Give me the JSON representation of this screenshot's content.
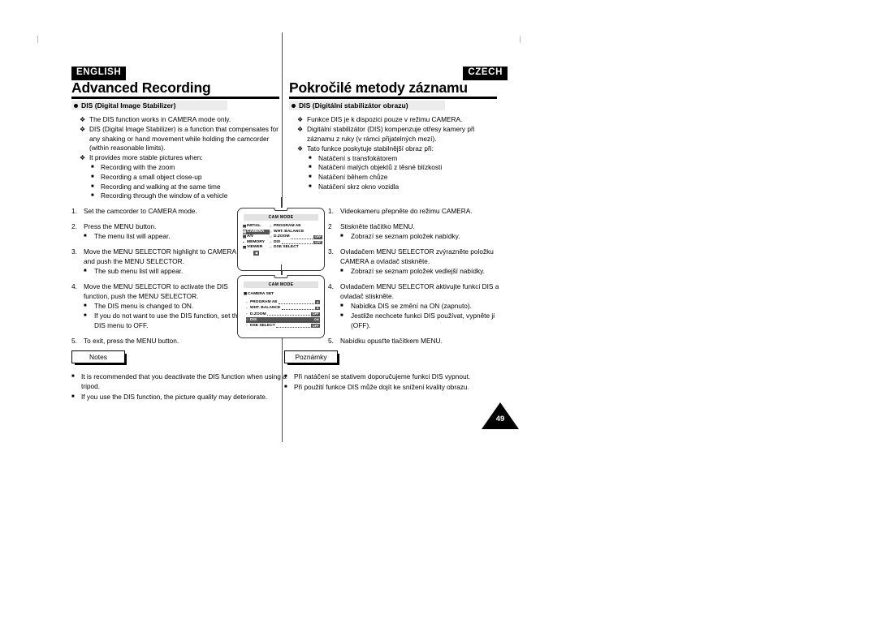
{
  "header": {
    "english_tag": "ENGLISH",
    "czech_tag": "CZECH",
    "title_en": "Advanced Recording",
    "title_cz": "Pokročilé metody záznamu"
  },
  "english": {
    "subheading": "DIS (Digital Image Stabilizer)",
    "features": [
      {
        "mark": "❖",
        "text": "The DIS function works in CAMERA mode only."
      },
      {
        "mark": "❖",
        "text": "DIS (Digital Image Stabilizer) is a function that compensates for any shaking or hand movement while holding the camcorder (within reasonable limits)."
      },
      {
        "mark": "❖",
        "text": "It provides more stable pictures when:"
      }
    ],
    "feature_subitems": [
      "Recording with the zoom",
      "Recording a small object close-up",
      "Recording and walking at the same time",
      "Recording through the window of a vehicle"
    ],
    "steps": [
      {
        "num": "1.",
        "text": "Set the camcorder to CAMERA mode.",
        "subs": []
      },
      {
        "num": "2.",
        "text": "Press the MENU button.",
        "subs": [
          "The menu list will appear."
        ]
      },
      {
        "num": "3.",
        "text": "Move the MENU SELECTOR highlight to CAMERA and push the MENU SELECTOR.",
        "subs": [
          "The sub menu list will appear."
        ]
      },
      {
        "num": "4.",
        "text": "Move the MENU SELECTOR to activate the DIS function, push the MENU SELECTOR.",
        "subs": [
          "The DIS menu is changed to ON.",
          "If you do not want to use the DIS function, set the DIS menu to OFF."
        ]
      },
      {
        "num": "5.",
        "text": "To exit, press the MENU button.",
        "subs": []
      }
    ],
    "notes_label": "Notes",
    "notes": [
      "It is recommended that you deactivate the DIS function when using a tripod.",
      "If you use the DIS function, the picture quality may deteriorate."
    ]
  },
  "czech": {
    "subheading": "DIS (Digitální stabilizátor obrazu)",
    "features": [
      {
        "mark": "❖",
        "text": "Funkce DIS je k dispozici pouze v režimu CAMERA."
      },
      {
        "mark": "❖",
        "text": "Digitální stabilizátor (DIS) kompenzuje otřesy kamery při záznamu z ruky (v rámci přijatelných mezí)."
      },
      {
        "mark": "❖",
        "text": "Tato funkce poskytuje stabilnější obraz při:"
      }
    ],
    "feature_subitems": [
      "Natáčení s transfokátorem",
      "Natáčení malých objektů z těsné blízkosti",
      "Natáčení během chůze",
      "Natáčení skrz okno vozidla"
    ],
    "steps": [
      {
        "num": "1.",
        "text": "Videokameru přepněte do režimu CAMERA.",
        "subs": []
      },
      {
        "num": "2",
        "text": "Stiskněte tlačítko MENU.",
        "subs": [
          "Zobrazí se seznam položek nabídky."
        ]
      },
      {
        "num": "3.",
        "text": "Ovladačem MENU SELECTOR zvýrazněte položku CAMERA a ovladač stiskněte.",
        "subs": [
          "Zobrazí se seznam položek vedlejší nabídky."
        ]
      },
      {
        "num": "4.",
        "text": "Ovladačem MENU SELECTOR aktivujte funkci DIS a ovladač stiskněte.",
        "subs": [
          "Nabídka DIS se změní na ON (zapnuto).",
          "Jestliže nechcete funkci DIS používat, vypněte ji (OFF)."
        ]
      },
      {
        "num": "5.",
        "text": "Nabídku opusťte tlačítkem MENU.",
        "subs": []
      }
    ],
    "notes_label": "Poznámky",
    "notes": [
      "Při natáčení se stativem doporučujeme funkci DIS vypnout.",
      "Při použití funkce DIS může dojít ke snížení kvality obrazu."
    ]
  },
  "lcd_screen_1": {
    "titlebar": "CAM MODE",
    "left_column": [
      {
        "label": "INITIAL",
        "highlighted": false
      },
      {
        "label": "CAMERA",
        "highlighted": true
      },
      {
        "label": "A/V",
        "highlighted": false
      },
      {
        "label": "MEMORY",
        "highlighted": false
      },
      {
        "label": "VIEWER",
        "highlighted": false
      }
    ],
    "return_label": "◀",
    "right_column": [
      {
        "label": "PROGRAM AE",
        "value": ""
      },
      {
        "label": "WHT. BALANCE",
        "value": ""
      },
      {
        "label": "D.ZOOM",
        "value": "OFF"
      },
      {
        "label": "DIS",
        "value": "OFF"
      },
      {
        "label": "DSE SELECT",
        "value": ""
      }
    ]
  },
  "lcd_screen_2": {
    "titlebar": "CAM MODE",
    "submenu_title": "CAMERA SET",
    "rows": [
      {
        "label": "PROGRAM AE",
        "value": "A",
        "highlighted": false
      },
      {
        "label": "WHT. BALANCE",
        "value": "A",
        "highlighted": false
      },
      {
        "label": "D.ZOOM",
        "value": "OFF",
        "highlighted": false
      },
      {
        "label": "DIS",
        "value": "ON",
        "highlighted": true
      },
      {
        "label": "DSE SELECT",
        "value": "OFF",
        "highlighted": false
      }
    ]
  },
  "page_number": "49"
}
